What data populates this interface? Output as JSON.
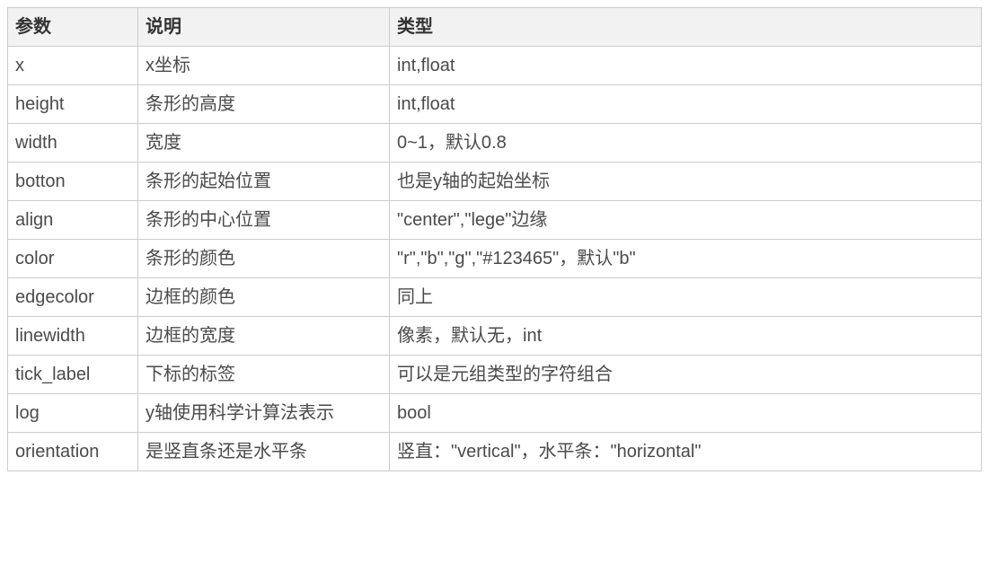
{
  "table": {
    "headers": {
      "param": "参数",
      "desc": "说明",
      "type": "类型"
    },
    "rows": [
      {
        "param": "x",
        "desc": "x坐标",
        "type": "int,float"
      },
      {
        "param": "height",
        "desc": "条形的高度",
        "type": "int,float"
      },
      {
        "param": "width",
        "desc": "宽度",
        "type": "0~1，默认0.8"
      },
      {
        "param": "botton",
        "desc": "条形的起始位置",
        "type": "也是y轴的起始坐标"
      },
      {
        "param": "align",
        "desc": "条形的中心位置",
        "type": "\"center\",\"lege\"边缘"
      },
      {
        "param": "color",
        "desc": "条形的颜色",
        "type": "\"r\",\"b\",\"g\",\"#123465\"，默认\"b\""
      },
      {
        "param": "edgecolor",
        "desc": "边框的颜色",
        "type": "同上"
      },
      {
        "param": "linewidth",
        "desc": "边框的宽度",
        "type": "像素，默认无，int"
      },
      {
        "param": "tick_label",
        "desc": "下标的标签",
        "type": "可以是元组类型的字符组合"
      },
      {
        "param": "log",
        "desc": "y轴使用科学计算法表示",
        "type": "bool"
      },
      {
        "param": "orientation",
        "desc": "是竖直条还是水平条",
        "type": "竖直：\"vertical\"，水平条：\"horizontal\""
      }
    ]
  }
}
